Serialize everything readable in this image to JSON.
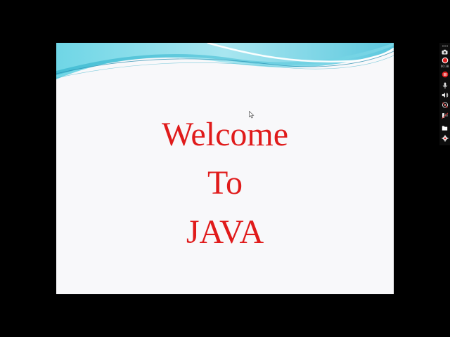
{
  "slide": {
    "line1": "Welcome",
    "line2": "To",
    "line3": "JAVA",
    "text_color": "#e01b1b",
    "background": "#f8f8fa",
    "wave_colors": [
      "#5fd3e3",
      "#9fe3ee",
      "#2fa9c7"
    ]
  },
  "recorder": {
    "elapsed": "00:38",
    "icons": [
      "more-icon",
      "camera-icon",
      "record-icon",
      "pause-icon",
      "mic-icon",
      "speaker-icon",
      "webcam-icon",
      "settings-icon",
      "folder-icon",
      "gear-icon"
    ],
    "record_color": "#e02020"
  }
}
